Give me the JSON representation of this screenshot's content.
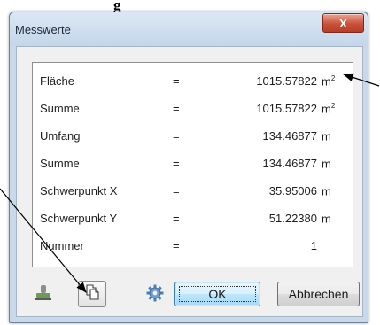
{
  "caption": "g",
  "window": {
    "title": "Messwerte",
    "close_label": "X"
  },
  "measurements": [
    {
      "label": "Fläche",
      "eq": "=",
      "value": "1015.57822",
      "unit": "m",
      "exp": "2"
    },
    {
      "label": "Summe",
      "eq": "=",
      "value": "1015.57822",
      "unit": "m",
      "exp": "2"
    },
    {
      "label": "Umfang",
      "eq": "=",
      "value": "134.46877",
      "unit": "m",
      "exp": ""
    },
    {
      "label": "Summe",
      "eq": "=",
      "value": "134.46877",
      "unit": "m",
      "exp": ""
    },
    {
      "label": "Schwerpunkt X",
      "eq": "=",
      "value": "35.95006",
      "unit": "m",
      "exp": ""
    },
    {
      "label": "Schwerpunkt Y",
      "eq": "=",
      "value": "51.22380",
      "unit": "m",
      "exp": ""
    },
    {
      "label": "Nummer",
      "eq": "=",
      "value": "1",
      "unit": "",
      "exp": ""
    }
  ],
  "buttons": {
    "ok": "OK",
    "cancel": "Abbrechen"
  },
  "icons": {
    "stamp": "stamp-icon",
    "copy": "copy-icon",
    "settings": "gear-icon"
  },
  "colors": {
    "close": "#c9523a",
    "ok_border": "#3c7fb1"
  }
}
